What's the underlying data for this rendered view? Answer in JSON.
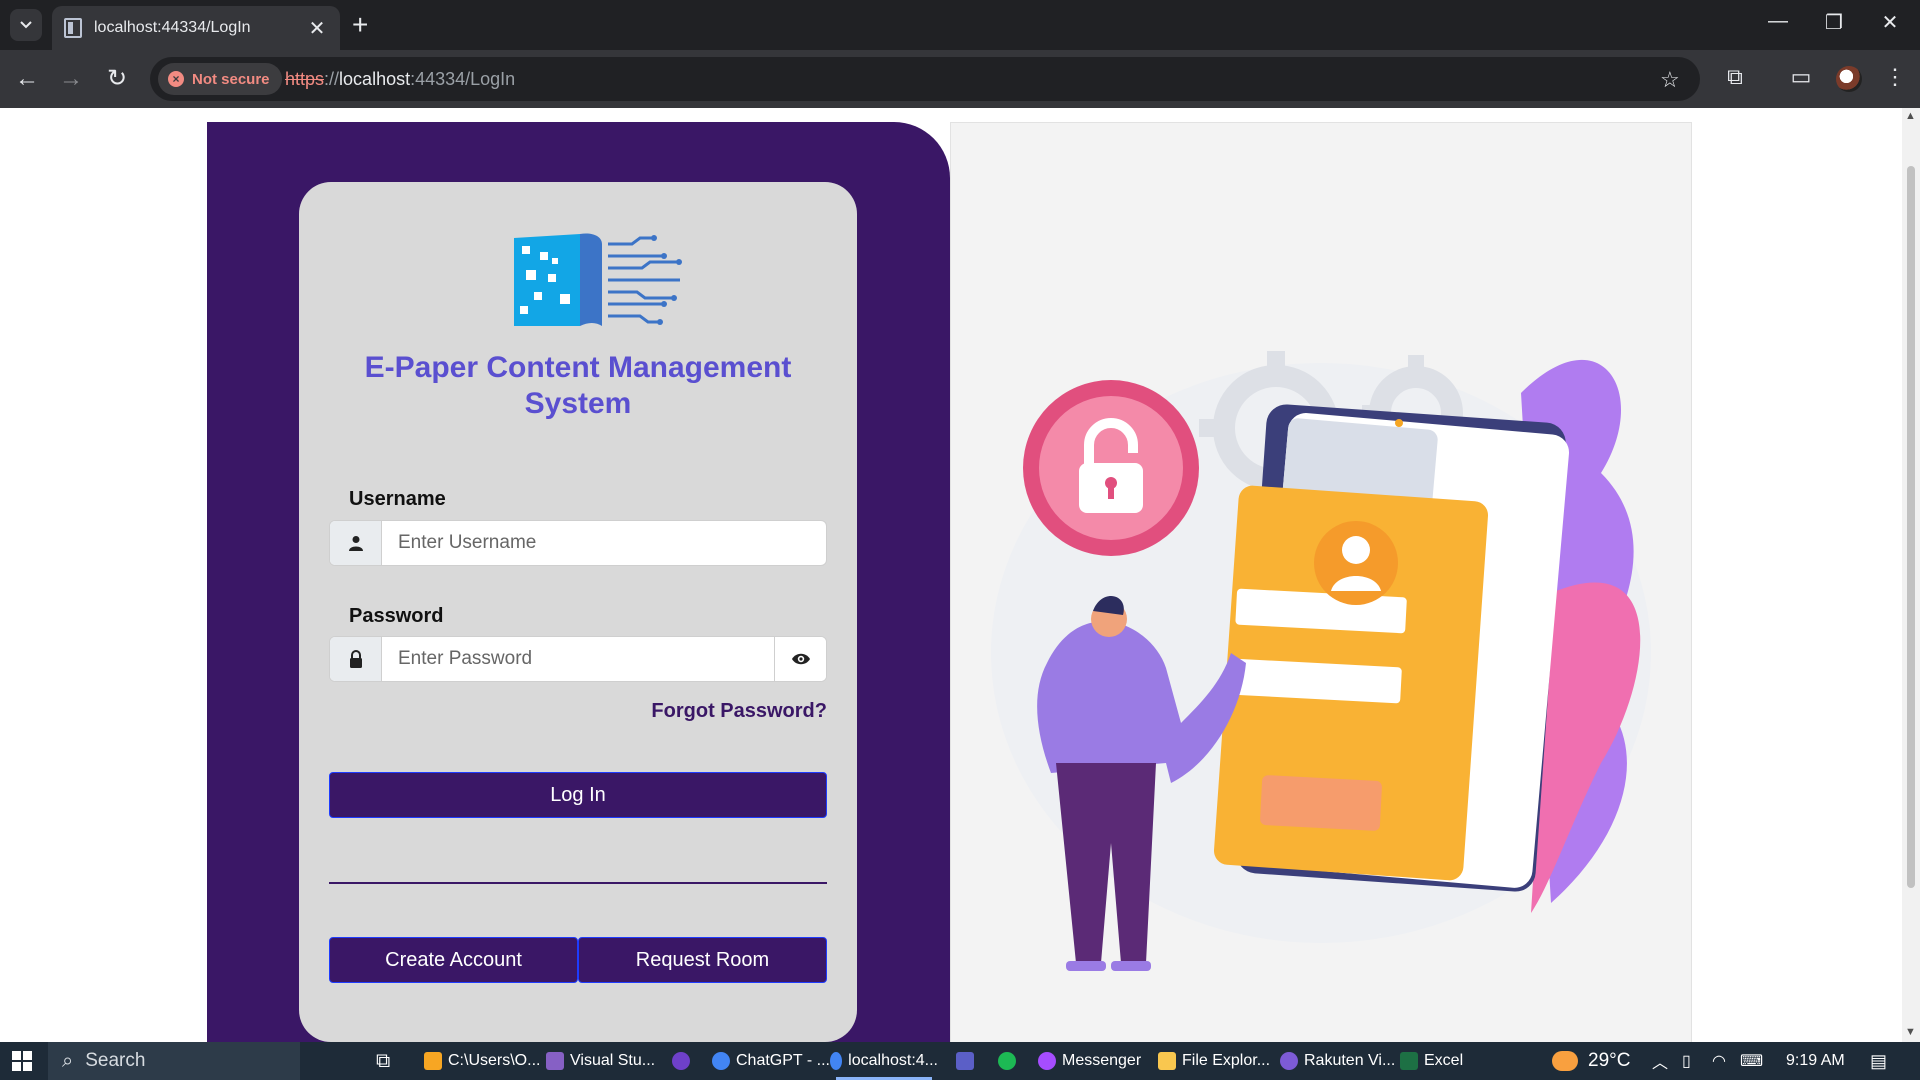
{
  "browser": {
    "tab_title": "localhost:44334/LogIn",
    "security_label": "Not secure",
    "url_scheme": "https",
    "url_sep": "://",
    "url_host": "localhost",
    "url_rest": ":44334/LogIn"
  },
  "login": {
    "app_title": "E-Paper Content Management System",
    "username_label": "Username",
    "username_placeholder": "Enter Username",
    "password_label": "Password",
    "password_placeholder": "Enter Password",
    "forgot_label": "Forgot Password?",
    "login_label": "Log In",
    "create_account_label": "Create Account",
    "request_room_label": "Request Room"
  },
  "taskbar": {
    "search_label": "Search",
    "apps": [
      {
        "label": "C:\\Users\\O...",
        "color": "#f7a623"
      },
      {
        "label": "Visual Stu...",
        "color": "#8660c5"
      },
      {
        "label": "ChatGPT - ...",
        "color": "#4285f4"
      },
      {
        "label": "localhost:4...",
        "color": "#4285f4"
      },
      {
        "label": "Messenger",
        "color": "#a64dff"
      },
      {
        "label": "File Explor...",
        "color": "#f9c74f"
      },
      {
        "label": "Rakuten Vi...",
        "color": "#7d5bd6"
      },
      {
        "label": "Excel",
        "color": "#1d7044"
      }
    ],
    "temperature": "29°C",
    "time": "9:19 AM"
  },
  "colors": {
    "brand_purple": "#3a1766",
    "title_accent": "#5a4fd0",
    "card_bg": "#d9d9d9"
  }
}
